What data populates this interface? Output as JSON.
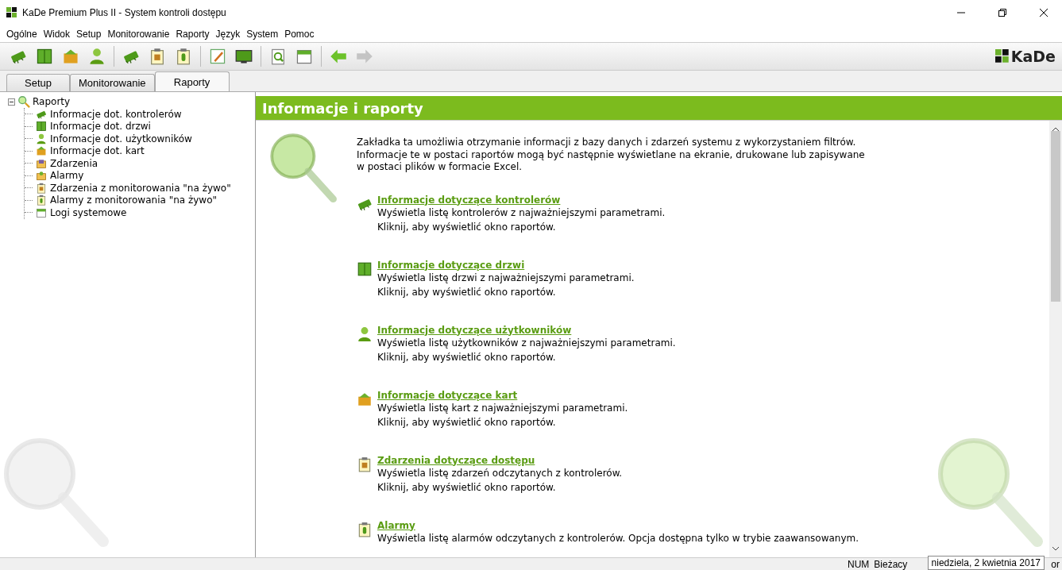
{
  "window": {
    "title": "KaDe Premium Plus II - System kontroli dostępu"
  },
  "menu": [
    "Ogólne",
    "Widok",
    "Setup",
    "Monitorowanie",
    "Raporty",
    "Język",
    "System",
    "Pomoc"
  ],
  "logo": "KaDe",
  "tabs": [
    {
      "label": "Setup",
      "selected": false
    },
    {
      "label": "Monitorowanie",
      "selected": false
    },
    {
      "label": "Raporty",
      "selected": true
    }
  ],
  "tree": {
    "label": "Raporty",
    "expanded": true,
    "children": [
      {
        "label": "Informacje dot. kontrolerów",
        "kind": "controller"
      },
      {
        "label": "Informacje dot. drzwi",
        "kind": "door"
      },
      {
        "label": "Informacje dot. użytkowników",
        "kind": "user"
      },
      {
        "label": "Informacje dot. kart",
        "kind": "card"
      },
      {
        "label": "Zdarzenia",
        "kind": "events"
      },
      {
        "label": "Alarmy",
        "kind": "alarms"
      },
      {
        "label": "Zdarzenia z monitorowania \"na żywo\"",
        "kind": "live-events"
      },
      {
        "label": "Alarmy z monitorowania \"na żywo\"",
        "kind": "live-alarms"
      },
      {
        "label": "Logi systemowe",
        "kind": "logs"
      }
    ]
  },
  "content": {
    "title": "Informacje i raporty",
    "intro": "Zakładka ta umożliwia otrzymanie informacji z bazy danych i zdarzeń systemu z wykorzystaniem filtrów.\nInformacje te w postaci raportów mogą być następnie wyświetlane na ekranie, drukowane lub zapisywane\nw postaci plików w formacie Excel.",
    "items": [
      {
        "kind": "controller",
        "title": "Informacje dotyczące kontrolerów",
        "description": "Wyświetla listę kontrolerów z najważniejszymi parametrami.",
        "hint": "Kliknij, aby wyświetlić okno raportów."
      },
      {
        "kind": "door",
        "title": "Informacje dotyczące drzwi",
        "description": "Wyświetla listę drzwi z najważniejszymi parametrami.",
        "hint": "Kliknij, aby wyświetlić okno raportów."
      },
      {
        "kind": "user",
        "title": "Informacje dotyczące użytkowników",
        "description": "Wyświetla listę użytkowników z najważniejszymi parametrami.",
        "hint": "Kliknij, aby wyświetlić okno raportów."
      },
      {
        "kind": "card",
        "title": "Informacje dotyczące kart",
        "description": "Wyświetla listę kart z najważniejszymi parametrami.",
        "hint": "Kliknij, aby wyświetlić okno raportów."
      },
      {
        "kind": "live-events",
        "title": "Zdarzenia dotyczące dostępu",
        "description": "Wyświetla listę zdarzeń odczytanych z kontrolerów.",
        "hint": "Kliknij, aby wyświetlić okno raportów."
      },
      {
        "kind": "live-alarms",
        "title": "Alarmy",
        "description": "Wyświetla listę alarmów odczytanych z kontrolerów. Opcja dostępna tylko w trybie zaawansowanym."
      }
    ]
  },
  "status_bar": {
    "num": "NUM",
    "current": "Bieżacy",
    "tooltip": "niedziela, 2 kwietnia 2017",
    "tail": "or"
  }
}
